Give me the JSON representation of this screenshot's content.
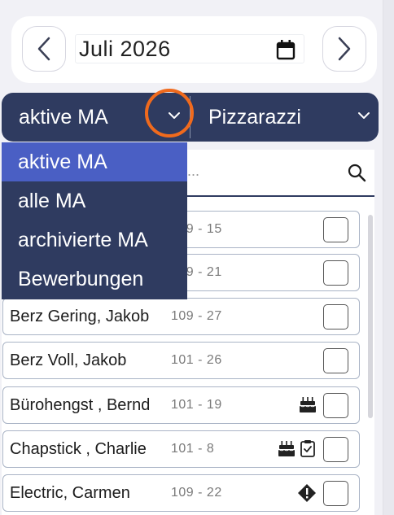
{
  "month": {
    "value": "Juli  2026"
  },
  "filters": {
    "status_selected": "aktive MA",
    "location_selected": "Pizzarazzi"
  },
  "dropdown": {
    "options": [
      "aktive MA",
      "alle MA",
      "archivierte MA",
      "Bewerbungen"
    ],
    "selected_index": 0
  },
  "search": {
    "placeholder": "..."
  },
  "employees": [
    {
      "name": "",
      "code": "109 - 15",
      "icons": []
    },
    {
      "name": "",
      "code": "109 - 21",
      "icons": []
    },
    {
      "name": "Berz Gering, Jakob",
      "code": "109 - 27",
      "icons": []
    },
    {
      "name": "Berz Voll, Jakob",
      "code": "101 - 26",
      "icons": []
    },
    {
      "name": "Bürohengst , Bernd",
      "code": "101 - 19",
      "icons": [
        "birthday-cake-icon"
      ]
    },
    {
      "name": "Chapstick , Charlie",
      "code": "101 - 8",
      "icons": [
        "birthday-cake-icon",
        "clipboard-check-icon"
      ]
    },
    {
      "name": "Electric, Carmen",
      "code": "109 - 22",
      "icons": [
        "warning-diamond-icon"
      ]
    }
  ],
  "colors": {
    "navy": "#2f3b60",
    "selected": "#4a5fc4",
    "highlight": "#f06a1d"
  }
}
